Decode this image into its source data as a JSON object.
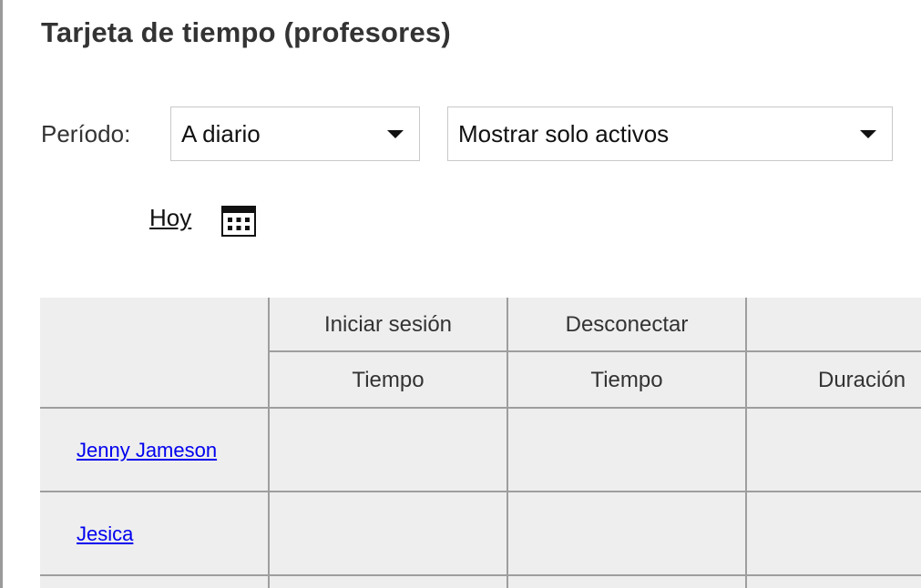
{
  "page": {
    "title": "Tarjeta de tiempo (profesores)"
  },
  "filters": {
    "period_label": "Período:",
    "period_value": "A diario",
    "status_value": "Mostrar solo activos"
  },
  "today_link": "Hoy",
  "icons": {
    "calendar": "calendar-icon",
    "dropdown": "caret-down-icon"
  },
  "table": {
    "group_headers": [
      "Iniciar sesión",
      "Desconectar"
    ],
    "sub_headers": [
      "Tiempo",
      "Tiempo",
      "Duración"
    ],
    "rows": [
      {
        "name": "Jenny Jameson"
      },
      {
        "name": "Jesica"
      }
    ]
  },
  "colors": {
    "link": "#0000ee",
    "table_bg": "#eeeeee",
    "grid": "#9e9e9e"
  }
}
